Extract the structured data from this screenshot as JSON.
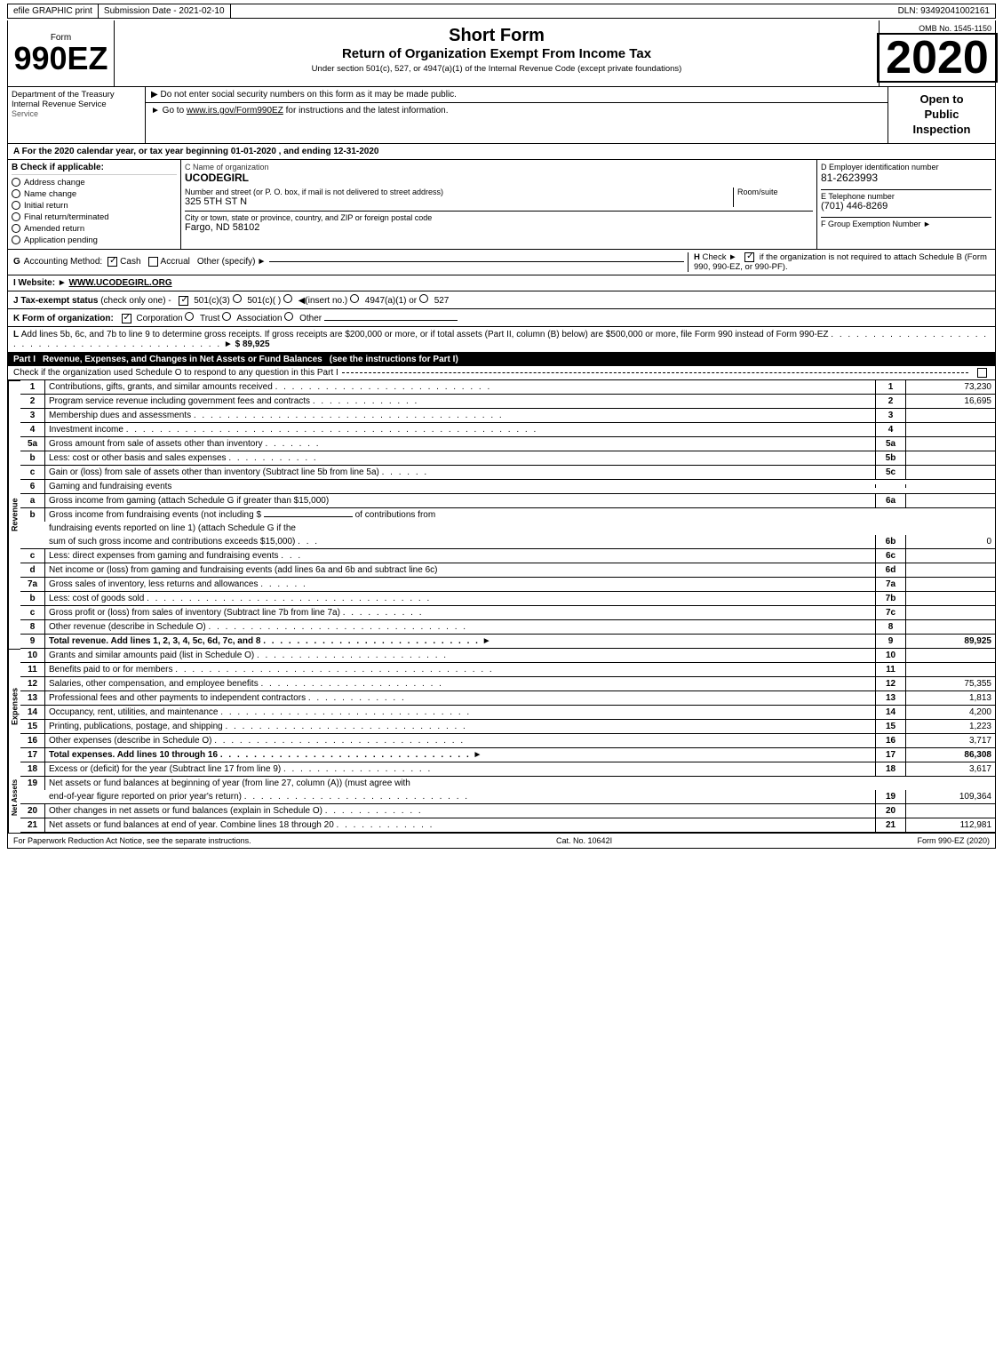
{
  "topBar": {
    "efile": "efile GRAPHIC print",
    "submission": "Submission Date - 2021-02-10",
    "dln": "DLN: 93492041002161"
  },
  "header": {
    "ombNo": "OMB No. 1545-1150",
    "formNumber": "990EZ",
    "formLabel": "Form",
    "shortFormTitle": "Short Form",
    "returnTitle": "Return of Organization Exempt From Income Tax",
    "subtitle": "Under section 501(c), 527, or 4947(a)(1) of the Internal Revenue Code (except private foundations)",
    "year": "2020",
    "notice1": "▶ Do not enter social security numbers on this form as it may be made public.",
    "notice2": "▶ Go to www.irs.gov/Form990EZ for instructions and the latest information.",
    "notice2Link": "www.irs.gov/Form990EZ",
    "openToPublic": "Open to Public Inspection",
    "dept1": "Department of the Treasury",
    "dept2": "Internal Revenue Service"
  },
  "sectionA": {
    "label": "A",
    "text": "For the 2020 calendar year, or tax year beginning 01-01-2020 , and ending 12-31-2020"
  },
  "checkApplicable": {
    "label": "B Check if applicable:",
    "items": [
      "Address change",
      "Name change",
      "Initial return",
      "Final return/terminated",
      "Amended return",
      "Application pending"
    ],
    "addressChecked": false,
    "nameChecked": false
  },
  "orgInfo": {
    "cLabel": "C Name of organization",
    "orgName": "UCODEGIRL",
    "streetLabel": "Number and street (or P. O. box, if mail is not delivered to street address)",
    "street": "325 5TH ST N",
    "roomLabel": "Room/suite",
    "cityLabel": "City or town, state or province, country, and ZIP or foreign postal code",
    "city": "Fargo, ND  58102"
  },
  "employerId": {
    "label": "D Employer identification number",
    "value": "81-2623993",
    "phoneLabel": "E Telephone number",
    "phone": "(701) 446-8269",
    "groupLabel": "F Group Exemption Number",
    "groupArrow": "▶"
  },
  "accounting": {
    "gLabel": "G",
    "gText": "Accounting Method:",
    "cash": "Cash",
    "cashChecked": true,
    "accrual": "Accrual",
    "accrualChecked": false,
    "other": "Other (specify)",
    "otherArrow": "▶",
    "hLabel": "H",
    "hCheck": "Check",
    "hArrow": "▶",
    "hText": "if the organization is not required to attach Schedule B (Form 990, 990-EZ, or 990-PF).",
    "hChecked": true
  },
  "website": {
    "label": "I Website:",
    "arrow": "▶",
    "url": "WWW.UCODEGIRL.ORG"
  },
  "taxExempt": {
    "label": "J Tax-exempt status",
    "note": "(check only one) -",
    "options": [
      "501(c)(3)",
      "501(c)(  )",
      "(insert no.)",
      "4947(a)(1) or",
      "527"
    ],
    "checked501c3": true
  },
  "formOrg": {
    "label": "K Form of organization:",
    "options": [
      "Corporation",
      "Trust",
      "Association",
      "Other"
    ],
    "checkedCorporation": true
  },
  "lineL": {
    "text": "L Add lines 5b, 6c, and 7b to line 9 to determine gross receipts. If gross receipts are $200,000 or more, or if total assets (Part II, column (B) below) are $500,000 or more, file Form 990 instead of Form 990-EZ",
    "dots": ". . . . . . . . . . . . . . . . . . . . . . . . . . . . . . . . . . . . . . . . . . . .",
    "arrow": "▶",
    "value": "$ 89,925"
  },
  "partI": {
    "title": "Part I",
    "description": "Revenue, Expenses, and Changes in Net Assets or Fund Balances",
    "note": "(see the instructions for Part I)",
    "checkText": "Check if the organization used Schedule O to respond to any question in this Part I",
    "lines": [
      {
        "num": "1",
        "desc": "Contributions, gifts, grants, and similar amounts received",
        "dots": true,
        "ref": "1",
        "value": "73,230"
      },
      {
        "num": "2",
        "desc": "Program service revenue including government fees and contracts",
        "dots": true,
        "ref": "2",
        "value": "16,695"
      },
      {
        "num": "3",
        "desc": "Membership dues and assessments",
        "dots": true,
        "ref": "3",
        "value": ""
      },
      {
        "num": "4",
        "desc": "Investment income",
        "dots": true,
        "ref": "4",
        "value": ""
      },
      {
        "num": "5a",
        "desc": "Gross amount from sale of assets other than inventory",
        "dots": false,
        "ref": "5a",
        "value": ""
      },
      {
        "num": "b",
        "desc": "Less: cost or other basis and sales expenses",
        "dots": false,
        "ref": "5b",
        "value": ""
      },
      {
        "num": "c",
        "desc": "Gain or (loss) from sale of assets other than inventory (Subtract line 5b from line 5a)",
        "dots": false,
        "ref": "5c",
        "value": ""
      },
      {
        "num": "6",
        "desc": "Gaming and fundraising events",
        "dots": false,
        "ref": "",
        "value": ""
      },
      {
        "num": "a",
        "desc": "Gross income from gaming (attach Schedule G if greater than $15,000)",
        "ref": "6a",
        "value": ""
      },
      {
        "num": "b",
        "desc": "Gross income from fundraising events (not including $",
        "ref": "6b",
        "value": "0"
      },
      {
        "num": "c",
        "desc": "Less: direct expenses from gaming and fundraising events",
        "ref": "6c",
        "value": ""
      },
      {
        "num": "d",
        "desc": "Net income or (loss) from gaming and fundraising events (add lines 6a and 6b and subtract line 6c)",
        "ref": "6d",
        "value": ""
      },
      {
        "num": "7a",
        "desc": "Gross sales of inventory, less returns and allowances",
        "ref": "7a",
        "value": ""
      },
      {
        "num": "b",
        "desc": "Less: cost of goods sold",
        "ref": "7b",
        "value": ""
      },
      {
        "num": "c",
        "desc": "Gross profit or (loss) from sales of inventory (Subtract line 7b from line 7a)",
        "ref": "7c",
        "value": ""
      },
      {
        "num": "8",
        "desc": "Other revenue (describe in Schedule O)",
        "dots": true,
        "ref": "8",
        "value": ""
      },
      {
        "num": "9",
        "desc": "Total revenue. Add lines 1, 2, 3, 4, 5c, 6d, 7c, and 8",
        "dots": true,
        "arrow": true,
        "ref": "9",
        "value": "89,925",
        "bold": true
      }
    ]
  },
  "expenses": {
    "lines": [
      {
        "num": "10",
        "desc": "Grants and similar amounts paid (list in Schedule O)",
        "dots": true,
        "ref": "10",
        "value": ""
      },
      {
        "num": "11",
        "desc": "Benefits paid to or for members",
        "dots": true,
        "ref": "11",
        "value": ""
      },
      {
        "num": "12",
        "desc": "Salaries, other compensation, and employee benefits",
        "dots": true,
        "ref": "12",
        "value": "75,355"
      },
      {
        "num": "13",
        "desc": "Professional fees and other payments to independent contractors",
        "dots": true,
        "ref": "13",
        "value": "1,813"
      },
      {
        "num": "14",
        "desc": "Occupancy, rent, utilities, and maintenance",
        "dots": true,
        "ref": "14",
        "value": "4,200"
      },
      {
        "num": "15",
        "desc": "Printing, publications, postage, and shipping",
        "dots": true,
        "ref": "15",
        "value": "1,223"
      },
      {
        "num": "16",
        "desc": "Other expenses (describe in Schedule O)",
        "dots": true,
        "ref": "16",
        "value": "3,717"
      },
      {
        "num": "17",
        "desc": "Total expenses. Add lines 10 through 16",
        "dots": true,
        "arrow": true,
        "ref": "17",
        "value": "86,308",
        "bold": true
      }
    ]
  },
  "netAssets": {
    "lines": [
      {
        "num": "18",
        "desc": "Excess or (deficit) for the year (Subtract line 17 from line 9)",
        "dots": true,
        "ref": "18",
        "value": "3,617"
      },
      {
        "num": "19",
        "desc": "Net assets or fund balances at beginning of year (from line 27, column (A)) (must agree with end-of-year figure reported on prior year's return)",
        "dots": true,
        "ref": "19",
        "value": "109,364"
      },
      {
        "num": "20",
        "desc": "Other changes in net assets or fund balances (explain in Schedule O)",
        "dots": true,
        "ref": "20",
        "value": ""
      },
      {
        "num": "21",
        "desc": "Net assets or fund balances at end of year. Combine lines 18 through 20",
        "dots": true,
        "ref": "21",
        "value": "112,981"
      }
    ]
  },
  "footer": {
    "paperwork": "For Paperwork Reduction Act Notice, see the separate instructions.",
    "catNo": "Cat. No. 10642I",
    "formRef": "Form 990-EZ (2020)"
  }
}
